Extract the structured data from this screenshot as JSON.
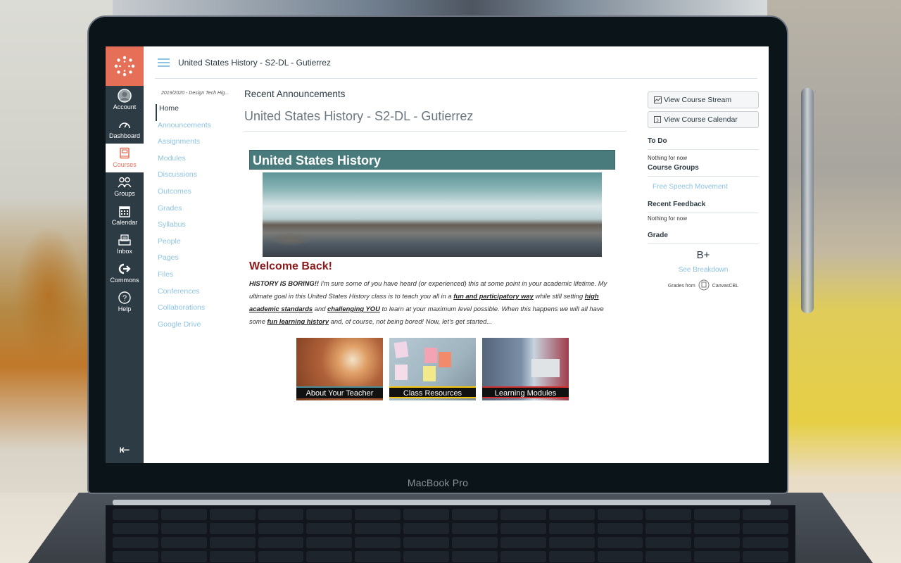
{
  "device": {
    "brand_label": "MacBook Pro"
  },
  "global_nav": {
    "items": [
      {
        "label": "Account",
        "icon": "account-avatar-icon"
      },
      {
        "label": "Dashboard",
        "icon": "dashboard-speedometer-icon"
      },
      {
        "label": "Courses",
        "icon": "courses-book-icon",
        "active": true
      },
      {
        "label": "Groups",
        "icon": "groups-people-icon"
      },
      {
        "label": "Calendar",
        "icon": "calendar-icon"
      },
      {
        "label": "Inbox",
        "icon": "inbox-tray-icon"
      },
      {
        "label": "Commons",
        "icon": "commons-arrow-icon"
      },
      {
        "label": "Help",
        "icon": "help-question-icon"
      }
    ],
    "collapse_icon": "collapse-arrow-icon",
    "accent": "#e66f58",
    "background": "#2d3b45"
  },
  "topbar": {
    "title": "United States History - S2-DL - Gutierrez"
  },
  "course_nav": {
    "term": "2019/2020 - Design Tech Hig...",
    "items": [
      "Home",
      "Announcements",
      "Assignments",
      "Modules",
      "Discussions",
      "Outcomes",
      "Grades",
      "Syllabus",
      "People",
      "Pages",
      "Files",
      "Conferences",
      "Collaborations",
      "Google Drive"
    ],
    "current": "Home",
    "link_color": "#8dc3e3"
  },
  "main": {
    "recent_announcements": "Recent Announcements",
    "course_title": "United States History - S2-DL - Gutierrez",
    "banner_title": "United States History",
    "welcome": "Welcome Back!",
    "intro": {
      "p1_bold": "HISTORY IS BORING!!",
      "p2": " I'm sure some of you have heard (or experienced) this at some point in your academic lifetime. My ultimate goal in this United States History class is to teach you all in a ",
      "p3_link": "fun and participatory way",
      "p4": " while still setting ",
      "p5_link": "high academic standards",
      "p6": " and ",
      "p7_link": "challenging YOU",
      "p8": " to learn at your maximum level possible. When this happens we will all have some ",
      "p9_link": "fun learning history",
      "p10": " and, of course, not being bored! Now, let's get started..."
    },
    "tiles": [
      {
        "label": "About Your Teacher"
      },
      {
        "label": "Class Resources"
      },
      {
        "label": "Learning Modules"
      }
    ]
  },
  "right_sidebar": {
    "buttons": [
      {
        "label": "View Course Stream",
        "icon": "stream-chart-icon"
      },
      {
        "label": "View Course Calendar",
        "icon": "calendar-icon"
      }
    ],
    "todo": {
      "heading": "To Do",
      "text": "Nothing for now"
    },
    "course_groups": {
      "heading": "Course Groups",
      "items": [
        "Free Speech Movement"
      ]
    },
    "recent_feedback": {
      "heading": "Recent Feedback",
      "text": "Nothing for now"
    },
    "grade": {
      "heading": "Grade",
      "value": "B+",
      "breakdown_link": "See Breakdown",
      "grades_from": "Grades from",
      "provider": "CanvasCBL"
    }
  }
}
